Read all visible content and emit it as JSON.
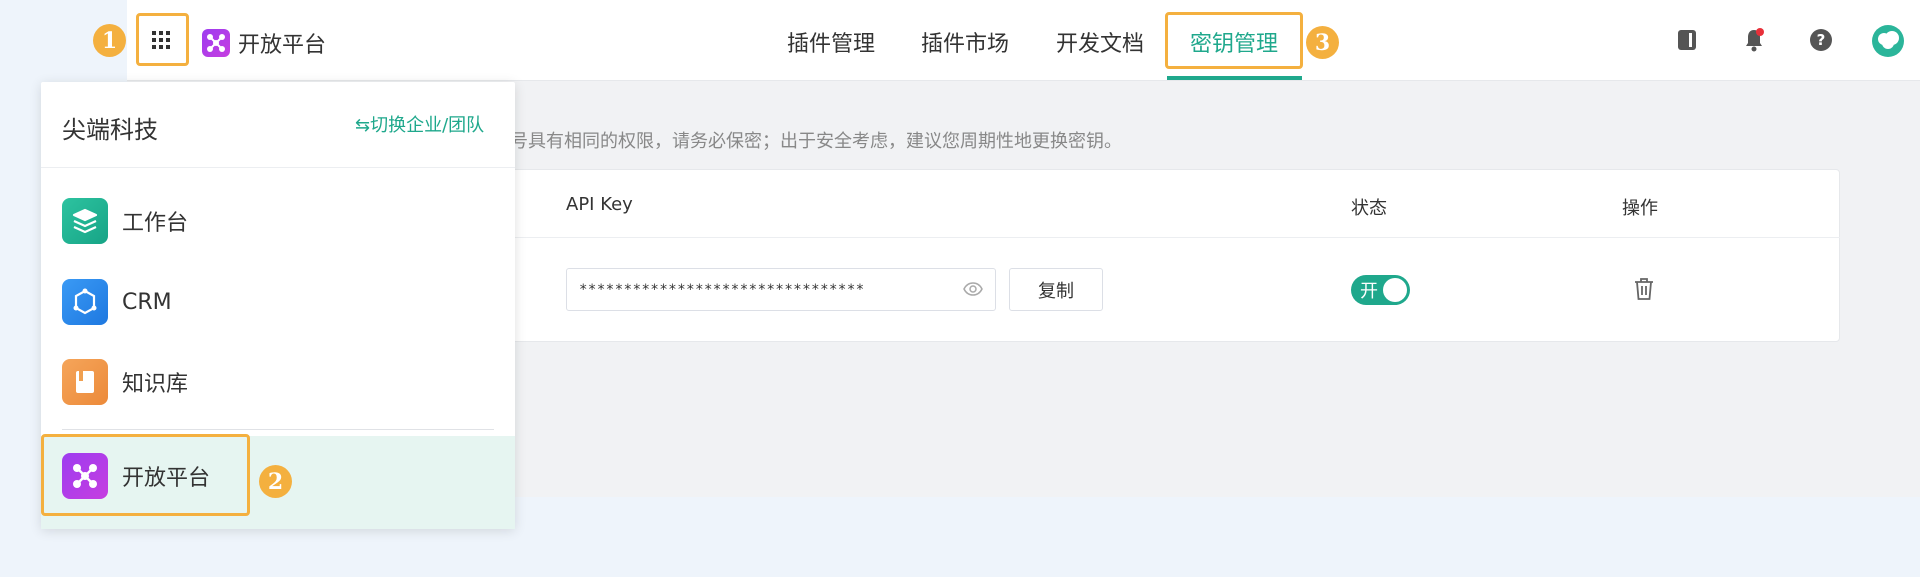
{
  "header": {
    "brand_name": "开放平台",
    "nav": [
      {
        "label": "插件管理"
      },
      {
        "label": "插件市场"
      },
      {
        "label": "开发文档"
      },
      {
        "label": "密钥管理"
      }
    ],
    "icons": [
      "notebook-icon",
      "bell-icon",
      "help-icon",
      "avatar"
    ]
  },
  "main": {
    "notice": "号具有相同的权限，请务必保密；出于安全考虑，建议您周期性地更换密钥。",
    "table": {
      "headers": [
        "API Key",
        "状态",
        "操作"
      ],
      "row": {
        "key_value": "********************************",
        "copy_label": "复制",
        "status_label": "开"
      }
    }
  },
  "panel": {
    "org_name": "尖端科技",
    "switch_label": "⇆切换企业/团队",
    "apps": [
      {
        "label": "工作台",
        "icon": "layers-icon"
      },
      {
        "label": "CRM",
        "icon": "hexagon-icon"
      },
      {
        "label": "知识库",
        "icon": "book-icon"
      },
      {
        "label": "开放平台",
        "icon": "molecule-icon"
      }
    ]
  },
  "annotations": [
    "1",
    "2",
    "3"
  ],
  "colors": {
    "accent": "#1fa88c",
    "highlight": "#f4b03f",
    "brand_purple": "#a53de8"
  }
}
